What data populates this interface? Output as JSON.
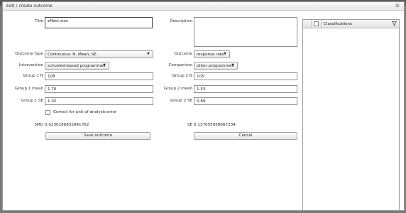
{
  "dialog": {
    "title": "Edit / create outcome"
  },
  "left": {
    "title_label": "Title",
    "title_value": "effect size",
    "outcome_type_label": "Outcome type",
    "outcome_type_value": "Continuous: N, Mean, SE",
    "intervention_label": "Intervention",
    "intervention_value": "schooled-based programmes",
    "group1_n_label": "Group 1 N",
    "group1_n_value": "108",
    "group1_mean_label": "Group 1 mean",
    "group1_mean_value": "1.76",
    "group1_se_label": "Group 1 SE",
    "group1_se_value": "1.02",
    "correct_label": "Correct for unit of analysis error",
    "smd_label": "SMD",
    "smd_value": "0.0230166832841762",
    "save_button": "Save outcome"
  },
  "right": {
    "description_label": "Description",
    "description_value": "",
    "outcome_label": "Outcome",
    "outcome_value": "response rate",
    "comparison_label": "Comparison",
    "comparison_value": "other programmes",
    "group2_n_label": "Group 2 N",
    "group2_n_value": "105",
    "group2_mean_label": "Group 2 mean",
    "group2_mean_value": "1.53",
    "group2_se_label": "Group 2 SE",
    "group2_se_value": "0.89",
    "se_label": "SE",
    "se_value": "0.137055958667234",
    "cancel_button": "Cancel"
  },
  "classifications": {
    "header": "Classifications"
  },
  "icons": {
    "close": "close-icon",
    "filter": "filter-icon",
    "dropdown": "chevron-down-icon"
  }
}
